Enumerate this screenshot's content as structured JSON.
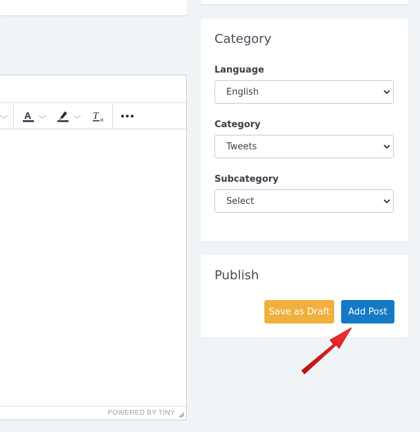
{
  "editor": {
    "powered_by": "POWERED BY TINY",
    "toolbar_icons": [
      "text-color-icon",
      "highlight-color-icon",
      "clear-formatting-icon",
      "more-icon"
    ]
  },
  "category_card": {
    "title": "Category",
    "fields": [
      {
        "label": "Language",
        "value": "English"
      },
      {
        "label": "Category",
        "value": "Tweets"
      },
      {
        "label": "Subcategory",
        "value": "Select"
      }
    ]
  },
  "publish_card": {
    "title": "Publish",
    "draft_label": "Save as Draft",
    "add_label": "Add Post"
  },
  "colors": {
    "background": "#f1f4f7",
    "draft_button": "#f0b03e",
    "add_button": "#1579c6",
    "annotation_arrow": "#e01e1e"
  }
}
